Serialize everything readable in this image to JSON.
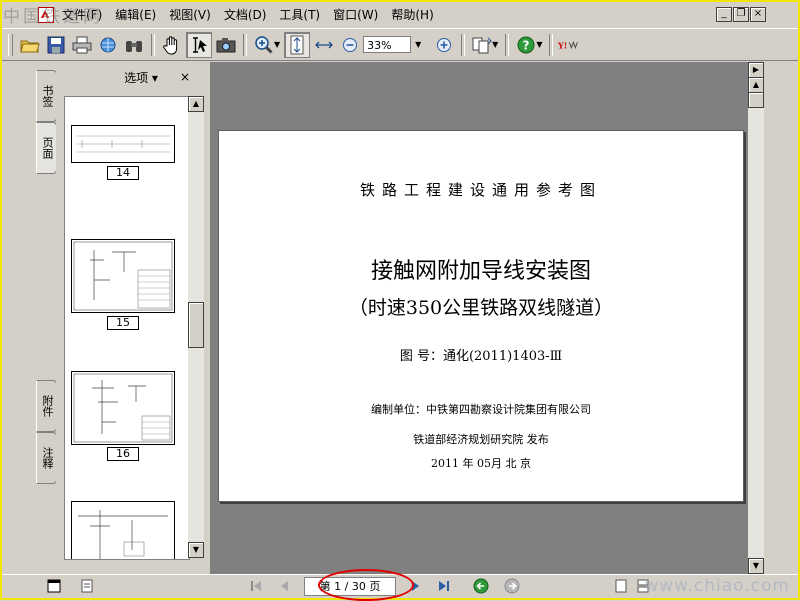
{
  "watermark": {
    "top_left": "中国铁道网",
    "bottom_right": "www.chiao.com"
  },
  "menu": [
    "文件(F)",
    "编辑(E)",
    "视图(V)",
    "文档(D)",
    "工具(T)",
    "窗口(W)",
    "帮助(H)"
  ],
  "window_controls": {
    "minimize": "_",
    "restore": "❐",
    "close": "×"
  },
  "toolbar": {
    "zoom_value": "33%"
  },
  "side_tabs": {
    "bookmarks": "书签",
    "pages": "页面",
    "attachments": "附件",
    "comments": "注释"
  },
  "panel": {
    "options_label": "选项 ▾",
    "close_label": "×"
  },
  "thumbnails": [
    {
      "label": "14"
    },
    {
      "label": "15"
    },
    {
      "label": "16"
    }
  ],
  "document": {
    "line1": "铁路工程建设通用参考图",
    "line2": "接触网附加导线安装图",
    "line3": "（时速350公里铁路双线隧道）",
    "line4": "图  号：通化(2011)1403-Ⅲ",
    "line5": "编制单位：中铁第四勘察设计院集团有限公司",
    "line6": "铁道部经济规划研究院      发布",
    "line7": "2011  年  05月              北  京"
  },
  "status": {
    "page_indicator": "第 1 / 30 页"
  },
  "colors": {
    "frame_border": "#f2e600",
    "highlight_ellipse": "#e00000",
    "doc_background": "#808080"
  }
}
